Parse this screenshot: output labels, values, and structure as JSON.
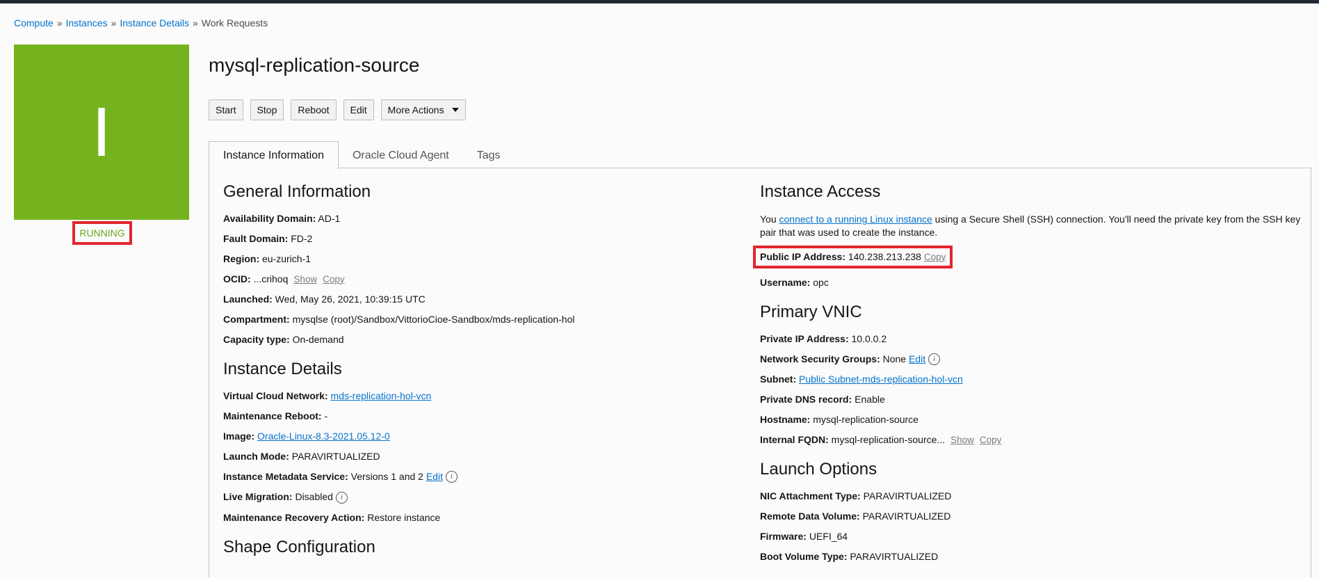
{
  "breadcrumb": {
    "items": [
      {
        "label": "Compute",
        "link": true
      },
      {
        "label": "Instances",
        "link": true
      },
      {
        "label": "Instance Details",
        "link": true
      },
      {
        "label": "Work Requests",
        "link": false
      }
    ],
    "separator": "»"
  },
  "badge": {
    "letter": "I",
    "state": "RUNNING",
    "color": "#74b31e"
  },
  "page_title": "mysql-replication-source",
  "actions": {
    "start": "Start",
    "stop": "Stop",
    "reboot": "Reboot",
    "edit": "Edit",
    "more": "More Actions"
  },
  "tabs": [
    "Instance Information",
    "Oracle Cloud Agent",
    "Tags"
  ],
  "general": {
    "title": "General Information",
    "availability_domain_label": "Availability Domain:",
    "availability_domain": "AD-1",
    "fault_domain_label": "Fault Domain:",
    "fault_domain": "FD-2",
    "region_label": "Region:",
    "region": "eu-zurich-1",
    "ocid_label": "OCID:",
    "ocid": "...crihoq",
    "show": "Show",
    "copy": "Copy",
    "launched_label": "Launched:",
    "launched": "Wed, May 26, 2021, 10:39:15 UTC",
    "compartment_label": "Compartment:",
    "compartment": "mysqlse (root)/Sandbox/VittorioCioe-Sandbox/mds-replication-hol",
    "capacity_label": "Capacity type:",
    "capacity": "On-demand"
  },
  "details": {
    "title": "Instance Details",
    "vcn_label": "Virtual Cloud Network:",
    "vcn": "mds-replication-hol-vcn",
    "maint_reboot_label": "Maintenance Reboot:",
    "maint_reboot": "-",
    "image_label": "Image:",
    "image": "Oracle-Linux-8.3-2021.05.12-0",
    "launch_mode_label": "Launch Mode:",
    "launch_mode": "PARAVIRTUALIZED",
    "imds_label": "Instance Metadata Service:",
    "imds": "Versions 1 and 2",
    "edit": "Edit",
    "live_migration_label": "Live Migration:",
    "live_migration": "Disabled",
    "recovery_label": "Maintenance Recovery Action:",
    "recovery": "Restore instance"
  },
  "shape": {
    "title": "Shape Configuration"
  },
  "access": {
    "title": "Instance Access",
    "text_before": "You ",
    "link": "connect to a running Linux instance",
    "text_after": " using a Secure Shell (SSH) connection. You'll need the private key from the SSH key pair that was used to create the instance.",
    "public_ip_label": "Public IP Address:",
    "public_ip": "140.238.213.238",
    "copy": "Copy",
    "username_label": "Username:",
    "username": "opc"
  },
  "vnic": {
    "title": "Primary VNIC",
    "private_ip_label": "Private IP Address:",
    "private_ip": "10.0.0.2",
    "nsg_label": "Network Security Groups:",
    "nsg": "None",
    "edit": "Edit",
    "subnet_label": "Subnet:",
    "subnet": "Public Subnet-mds-replication-hol-vcn",
    "dns_label": "Private DNS record:",
    "dns": "Enable",
    "hostname_label": "Hostname:",
    "hostname": "mysql-replication-source",
    "fqdn_label": "Internal FQDN:",
    "fqdn": "mysql-replication-source...",
    "show": "Show",
    "copy": "Copy"
  },
  "launch": {
    "title": "Launch Options",
    "nic_label": "NIC Attachment Type:",
    "nic": "PARAVIRTUALIZED",
    "rdv_label": "Remote Data Volume:",
    "rdv": "PARAVIRTUALIZED",
    "firmware_label": "Firmware:",
    "firmware": "UEFI_64",
    "boot_label": "Boot Volume Type:",
    "boot": "PARAVIRTUALIZED"
  }
}
